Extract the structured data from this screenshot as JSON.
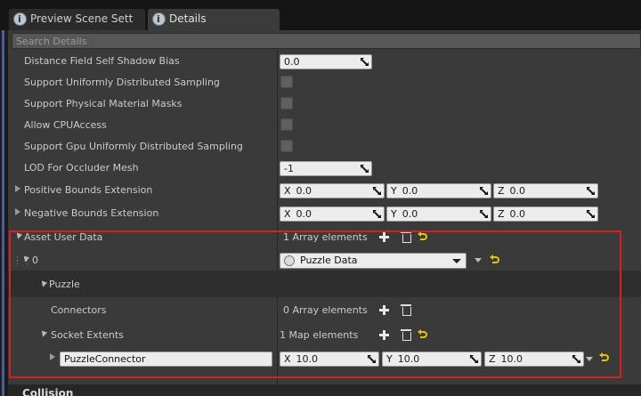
{
  "tabs": [
    {
      "label": "Preview Scene Sett",
      "active": false
    },
    {
      "label": "Details",
      "active": true
    }
  ],
  "search": {
    "placeholder": "Search Details"
  },
  "properties": {
    "distance_field": {
      "label": "Distance Field Self Shadow Bias",
      "value": "0.0"
    },
    "uniform_sampling": {
      "label": "Support Uniformly Distributed Sampling"
    },
    "phys_material_masks": {
      "label": "Support Physical Material Masks"
    },
    "cpu_access": {
      "label": "Allow CPUAccess"
    },
    "gpu_sampling": {
      "label": "Support Gpu Uniformly Distributed Sampling"
    },
    "lod_occluder": {
      "label": "LOD For Occluder Mesh",
      "value": "-1"
    },
    "pos_bounds": {
      "label": "Positive Bounds Extension",
      "x": "0.0",
      "y": "0.0",
      "z": "0.0"
    },
    "neg_bounds": {
      "label": "Negative Bounds Extension",
      "x": "0.0",
      "y": "0.0",
      "z": "0.0"
    },
    "asset_user_data": {
      "label": "Asset User Data",
      "count": "1 Array elements"
    },
    "element0": {
      "label": "0",
      "value": "Puzzle Data"
    },
    "puzzle": {
      "label": "Puzzle"
    },
    "connectors": {
      "label": "Connectors",
      "count": "0 Array elements"
    },
    "socket_extents": {
      "label": "Socket Extents",
      "count": "1 Map elements"
    },
    "puzzle_connector": {
      "key": "PuzzleConnector",
      "x": "10.0",
      "y": "10.0",
      "z": "10.0"
    }
  },
  "axes": {
    "x": "X",
    "y": "Y",
    "z": "Z"
  },
  "footer": {
    "section": "Collision"
  },
  "colors": {
    "highlight": "#d81e1e",
    "reset": "#e0c800"
  }
}
